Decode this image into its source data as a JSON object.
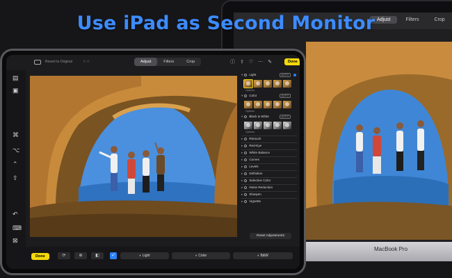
{
  "headline": "Use iPad as Second Monitor",
  "macbook": {
    "label": "MacBook Pro",
    "tabs": [
      {
        "label": "Adjust",
        "active": true
      },
      {
        "label": "Filters",
        "active": false
      },
      {
        "label": "Crop",
        "active": false
      }
    ]
  },
  "ipad": {
    "topbar": {
      "revert_label": "Revert to Original",
      "tabs": [
        {
          "label": "Adjust",
          "active": true
        },
        {
          "label": "Filters",
          "active": false
        },
        {
          "label": "Crop",
          "active": false
        }
      ],
      "done_label": "Done"
    },
    "panel": {
      "sections": [
        {
          "label": "Light",
          "auto": "AUTO",
          "enabled": true
        },
        {
          "label": "Color",
          "auto": "AUTO",
          "enabled": false
        },
        {
          "label": "Black & White",
          "auto": "AUTO",
          "enabled": false
        }
      ],
      "options_label": "Options",
      "tools": [
        "Retouch",
        "Red-Eye",
        "White Balance",
        "Curves",
        "Levels",
        "Definition",
        "Selective Color",
        "Noise Reduction",
        "Sharpen",
        "Vignette"
      ],
      "reset_label": "Reset Adjustments"
    },
    "bottombar": {
      "done_label": "Done",
      "buttons": [
        "Light",
        "Color",
        "B&W"
      ]
    }
  },
  "colors": {
    "headline": "#3d8bff",
    "accent_yellow": "#f5d90a",
    "accent_blue": "#2c83ff",
    "panel_bg": "#1c1c1e"
  }
}
